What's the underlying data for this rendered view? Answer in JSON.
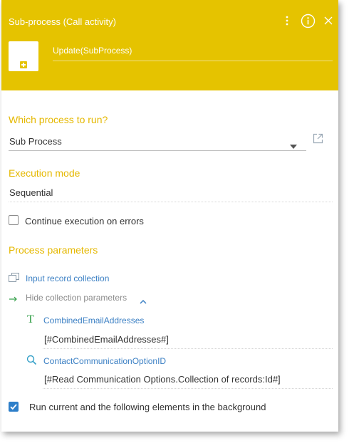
{
  "header": {
    "title": "Sub-process (Call activity)",
    "element_name": "Update(SubProcess)",
    "icons": [
      "more-vertical-icon",
      "info-icon",
      "close-icon"
    ],
    "background_color": "#e5c300"
  },
  "process_section": {
    "label": "Which process to run?",
    "selected_value": "Sub Process"
  },
  "execution_section": {
    "label": "Execution mode",
    "value": "Sequential"
  },
  "continue_on_errors": {
    "label": "Continue execution on errors",
    "checked": false
  },
  "parameters_section": {
    "label": "Process parameters",
    "collection_link": "Input record collection",
    "hide_link": "Hide collection parameters",
    "params": [
      {
        "name": "CombinedEmailAddresses",
        "value": "[#CombinedEmailAddresses#]",
        "icon": "text-type-icon"
      },
      {
        "name": "ContactCommunicationOptionID",
        "value": "[#Read Communication Options.Collection of records:Id#]",
        "icon": "lookup-icon"
      }
    ]
  },
  "background_option": {
    "label": "Run current and the following elements in the background",
    "checked": true
  },
  "colors": {
    "accent": "#e5b800",
    "link": "#3c80c4",
    "checkbox_checked": "#2d7ec9"
  }
}
